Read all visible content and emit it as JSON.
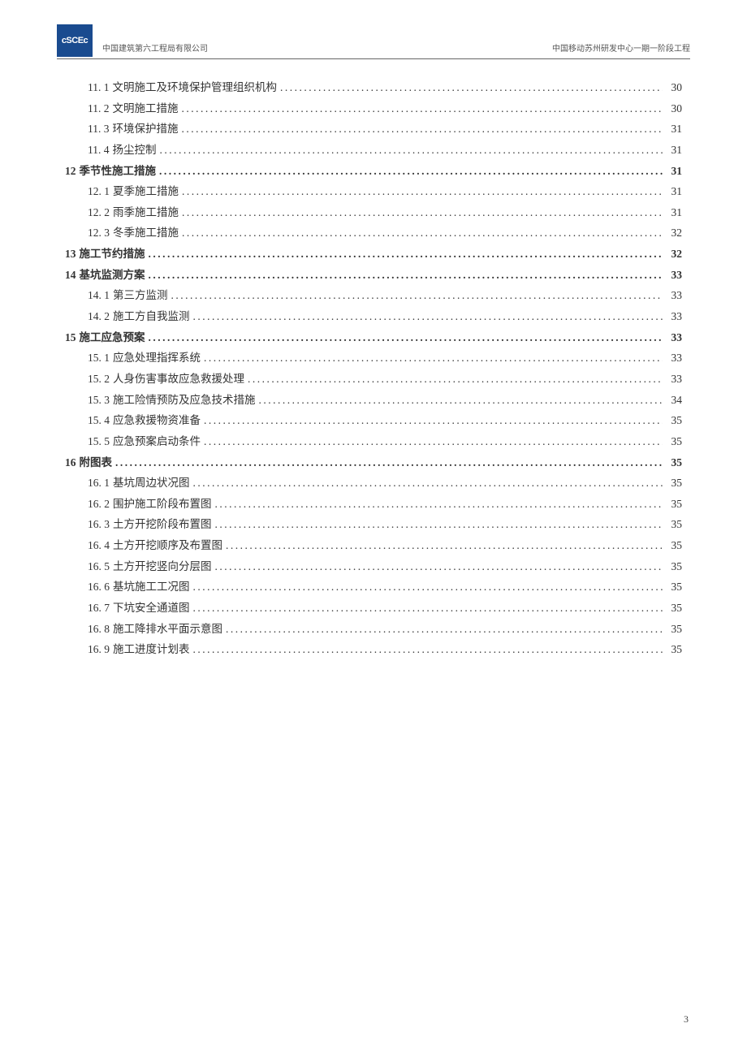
{
  "header": {
    "logo_text": "cSCEc",
    "company": "中国建筑第六工程局有限公司",
    "project": "中国移动苏州研发中心一期一阶段工程"
  },
  "toc": [
    {
      "level": 2,
      "num": "11. 1",
      "title": "文明施工及环境保护管理组织机构",
      "page": "30"
    },
    {
      "level": 2,
      "num": "11. 2",
      "title": "文明施工措施",
      "page": "30"
    },
    {
      "level": 2,
      "num": "11. 3",
      "title": "环境保护措施",
      "page": "31"
    },
    {
      "level": 2,
      "num": "11. 4",
      "title": "扬尘控制",
      "page": "31"
    },
    {
      "level": 1,
      "num": "12",
      "title": "季节性施工措施",
      "page": "31"
    },
    {
      "level": 2,
      "num": "12. 1",
      "title": "夏季施工措施",
      "page": "31"
    },
    {
      "level": 2,
      "num": "12. 2",
      "title": "雨季施工措施",
      "page": "31"
    },
    {
      "level": 2,
      "num": "12. 3",
      "title": "冬季施工措施",
      "page": "32"
    },
    {
      "level": 1,
      "num": "13",
      "title": "施工节约措施",
      "page": "32"
    },
    {
      "level": 1,
      "num": "14",
      "title": "基坑监测方案",
      "page": "33"
    },
    {
      "level": 2,
      "num": "14. 1",
      "title": "第三方监测",
      "page": "33"
    },
    {
      "level": 2,
      "num": "14. 2",
      "title": "施工方自我监测",
      "page": "33"
    },
    {
      "level": 1,
      "num": "15",
      "title": "施工应急预案",
      "page": "33"
    },
    {
      "level": 2,
      "num": "15. 1",
      "title": "应急处理指挥系统",
      "page": "33"
    },
    {
      "level": 2,
      "num": "15. 2",
      "title": "人身伤害事故应急救援处理",
      "page": "33"
    },
    {
      "level": 2,
      "num": "15. 3",
      "title": "施工险情预防及应急技术措施",
      "page": "34"
    },
    {
      "level": 2,
      "num": "15. 4",
      "title": "应急救援物资准备",
      "page": "35"
    },
    {
      "level": 2,
      "num": "15. 5",
      "title": "应急预案启动条件",
      "page": "35"
    },
    {
      "level": 1,
      "num": "16",
      "title": "附图表",
      "page": "35"
    },
    {
      "level": 2,
      "num": "16. 1",
      "title": "基坑周边状况图",
      "page": "35"
    },
    {
      "level": 2,
      "num": "16. 2",
      "title": "围护施工阶段布置图",
      "page": "35"
    },
    {
      "level": 2,
      "num": "16. 3",
      "title": "土方开挖阶段布置图",
      "page": "35"
    },
    {
      "level": 2,
      "num": "16. 4",
      "title": "土方开挖顺序及布置图",
      "page": "35"
    },
    {
      "level": 2,
      "num": "16. 5",
      "title": "土方开挖竖向分层图",
      "page": "35"
    },
    {
      "level": 2,
      "num": "16. 6",
      "title": "基坑施工工况图",
      "page": "35"
    },
    {
      "level": 2,
      "num": "16. 7",
      "title": "下坑安全通道图",
      "page": "35"
    },
    {
      "level": 2,
      "num": "16. 8",
      "title": "施工降排水平面示意图",
      "page": "35"
    },
    {
      "level": 2,
      "num": "16. 9",
      "title": "施工进度计划表",
      "page": "35"
    }
  ],
  "page_number": "3"
}
